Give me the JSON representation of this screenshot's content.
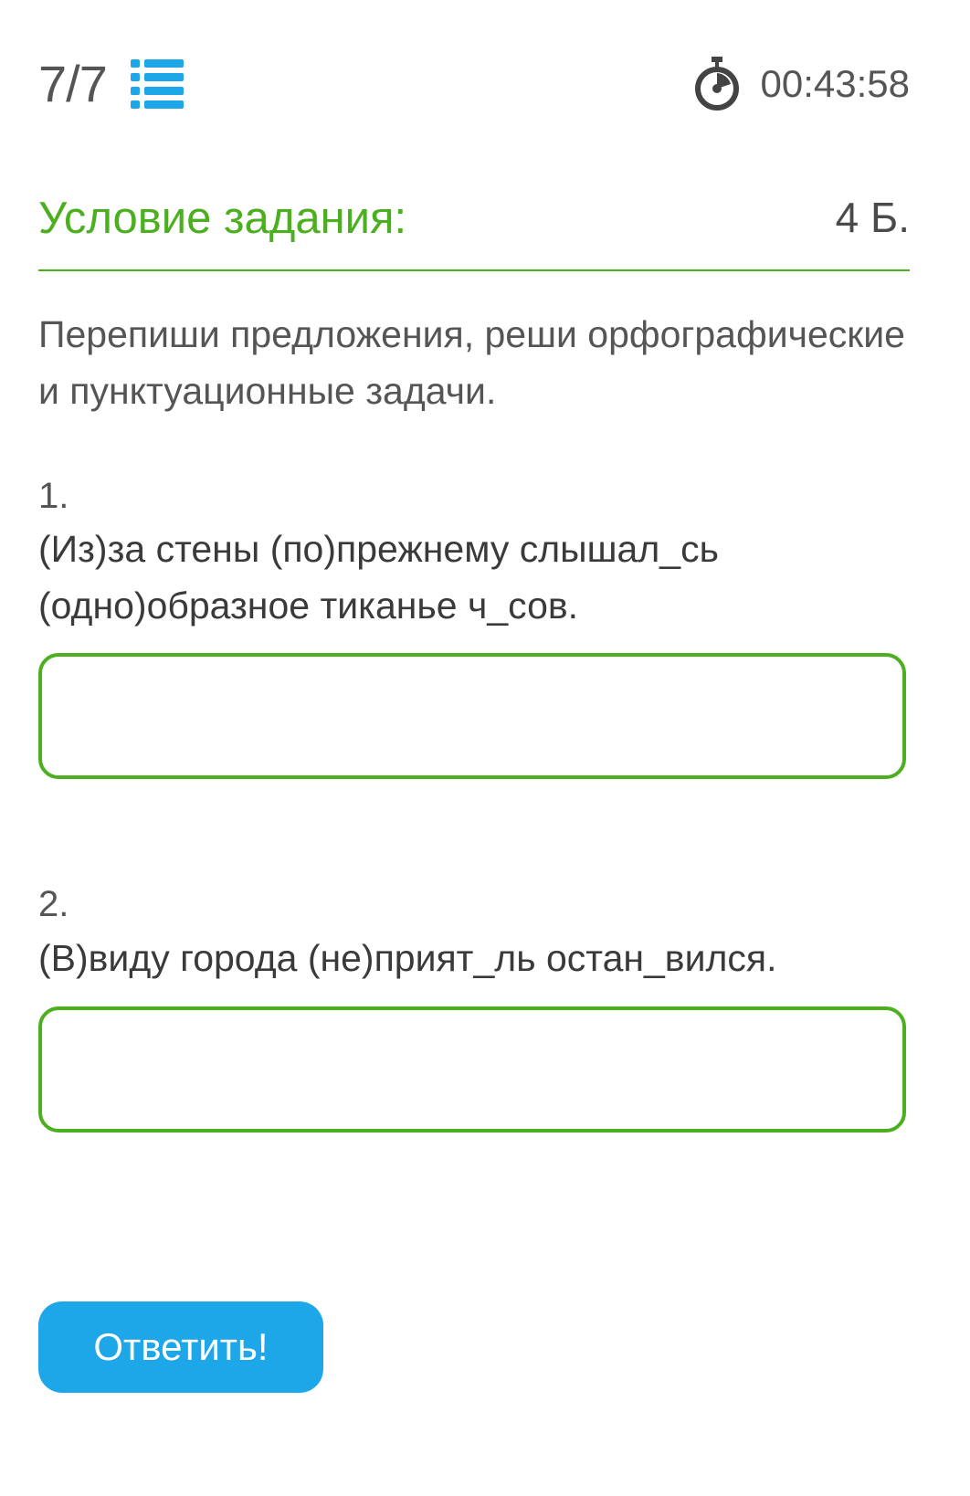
{
  "topbar": {
    "counter": "7/7",
    "list_icon": "list-icon",
    "timer_icon": "stopwatch-icon",
    "timer": "00:43:58"
  },
  "task": {
    "title": "Условие задания:",
    "points": "4 Б.",
    "instruction": "Перепиши предложения, реши орфографические и пунктуационные задачи."
  },
  "questions": [
    {
      "number": "1.",
      "text": "(Из)за стены (по)прежнему слышал_сь (одно)образное тиканье ч_сов.",
      "answer_value": ""
    },
    {
      "number": "2.",
      "text": "(В)виду города (не)прият_ль остан_вился.",
      "answer_value": ""
    }
  ],
  "submit_label": "Ответить!",
  "colors": {
    "accent_green": "#4caf1f",
    "button_blue": "#1da7e8",
    "icon_blue": "#1da7e8"
  }
}
